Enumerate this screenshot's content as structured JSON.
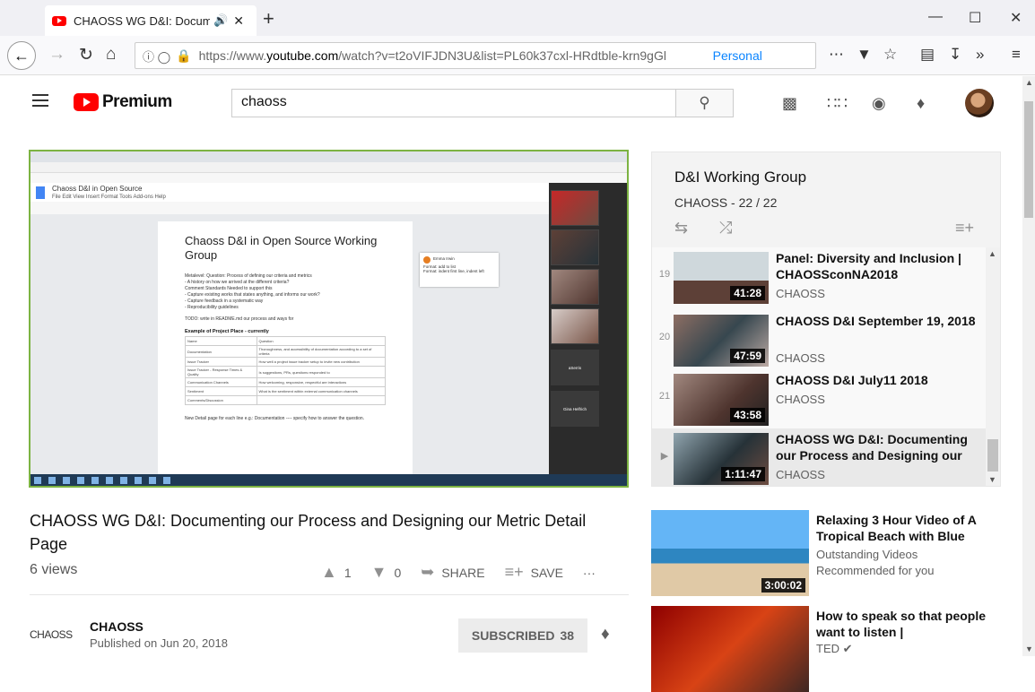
{
  "browser": {
    "tab_title": "CHAOSS WG D&I: Documen",
    "url_prefix": "https://www.",
    "url_domain": "youtube.com",
    "url_rest": "/watch?v=t2oVIFJDN3U&list=PL60k37cxl-HRdtble-krn9gGl",
    "personal_label": "Personal"
  },
  "header": {
    "logo_text": "Premium",
    "search_value": "chaoss"
  },
  "player": {
    "doc_title": "Chaoss D&I in Open Source",
    "doc_menu": "File  Edit  View  Insert  Format  Tools  Add-ons  Help",
    "doc_heading": "Chaoss D&I in Open Source Working Group",
    "doc_lines": [
      "Metalevel: Question: Process of defining our criteria and metrics",
      "-  A history on how we arrived at the different criteria?",
      "        Comment Standards Needed to support this",
      "-  Capture existing works that states anything, and informs our work?",
      "-  Capture feedback in a systematic way",
      "-  Reproducibility guidelines",
      "TODO: write in README.md our process and ways for"
    ],
    "doc_subheading": "Example of Project Place - currently",
    "doc_table": [
      [
        "Name",
        "Question"
      ],
      [
        "Documentation",
        "Thoroughness, and accessibility of documentation according to a set of criteria"
      ],
      [
        "Issue Tracker",
        "How well a project issue tracker setup to invite new contribution"
      ],
      [
        "Issue Tracker - Response Times & Quality",
        "Is suggestions, PRs, questions responded to"
      ],
      [
        "Communication Channels",
        "How welcoming, responsive, respectful are interactions"
      ],
      [
        "Sentiment",
        "What is the sentiment within external communication channels"
      ],
      [
        "Comments/Discussion",
        ""
      ]
    ],
    "doc_footer": "New Detail page for each line e.g.: Documentation ---- specify how to answer the question.",
    "comment_author": "Emma Irwin",
    "comment_text": "Format: add to list",
    "comment_text2": "Format: indent first line, indent left",
    "participants": [
      "aSerris",
      "Gina Helfrich"
    ]
  },
  "video": {
    "title": "CHAOSS WG D&I: Documenting our Process and Designing our Metric Detail Page",
    "views": "6 views",
    "likes": "1",
    "dislikes": "0",
    "share_label": "SHARE",
    "save_label": "SAVE",
    "more_label": "···"
  },
  "channel": {
    "logo_text": "CHAOSS",
    "name": "CHAOSS",
    "published": "Published on Jun 20, 2018",
    "subscribe_label": "SUBSCRIBED",
    "subscriber_count": "38"
  },
  "playlist": {
    "title": "D&I Working Group",
    "meta": "CHAOSS - 22 / 22",
    "items": [
      {
        "index": "19",
        "title": "Panel: Diversity and Inclusion | CHAOSSconNA2018",
        "channel": "CHAOSS",
        "duration": "41:28"
      },
      {
        "index": "20",
        "title": "CHAOSS D&I September 19, 2018",
        "channel": "CHAOSS",
        "duration": "47:59"
      },
      {
        "index": "21",
        "title": "CHAOSS D&I July11 2018",
        "channel": "CHAOSS",
        "duration": "43:58"
      },
      {
        "index": "▶",
        "title": "CHAOSS WG D&I: Documenting our Process and Designing our",
        "channel": "CHAOSS",
        "duration": "1:11:47"
      }
    ]
  },
  "recommendations": [
    {
      "title": "Relaxing 3 Hour Video of A Tropical Beach with Blue",
      "channel": "Outstanding Videos",
      "note": "Recommended for you",
      "duration": "3:00:02"
    },
    {
      "title": "How to speak so that people want to listen |",
      "channel": "TED",
      "note": "",
      "duration": ""
    }
  ],
  "colors": {
    "youtube_red": "#ff0000",
    "player_border": "#7cb342",
    "link_blue": "#0a84ff"
  }
}
